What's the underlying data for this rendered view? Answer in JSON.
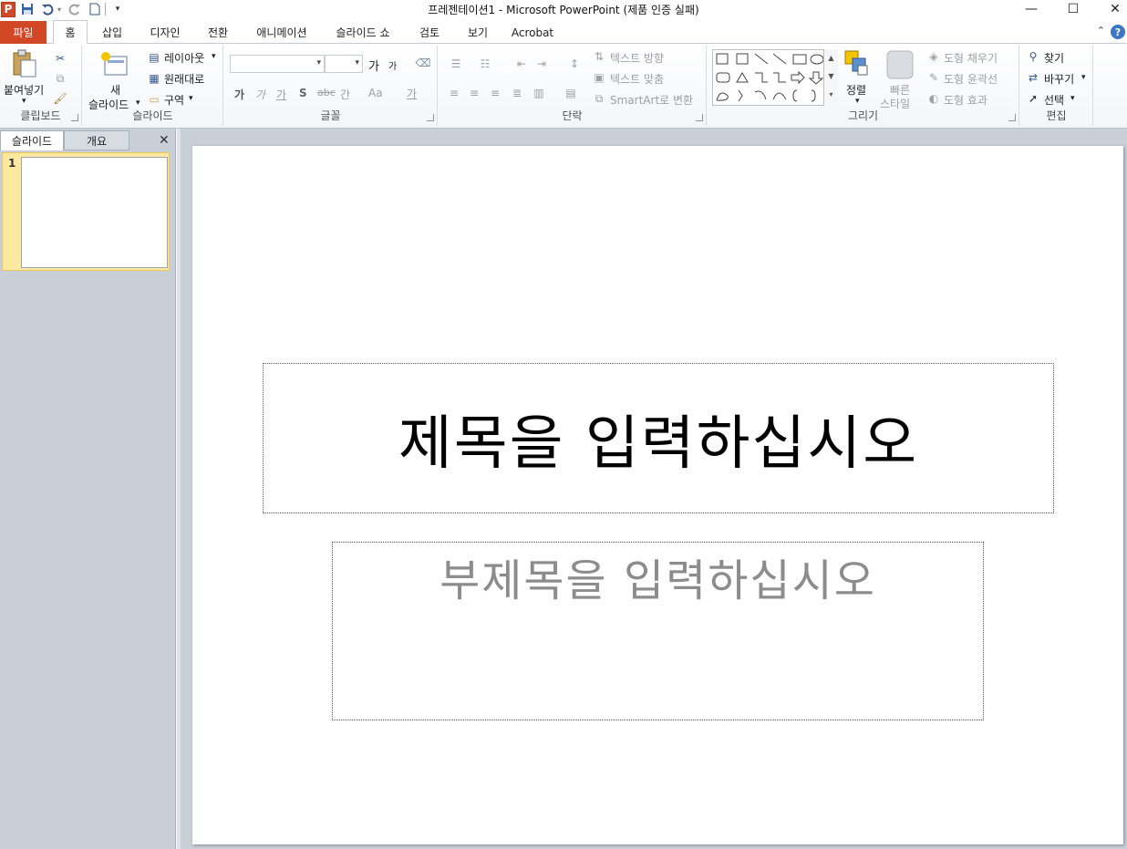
{
  "window": {
    "title": "프레젠테이션1  -  Microsoft PowerPoint (제품 인증 실패)",
    "app_icon_letter": "P",
    "controls": {
      "minimize": "—",
      "maximize": "☐",
      "close": "✕"
    }
  },
  "quick_access": [
    "save-icon",
    "undo-icon",
    "redo-icon",
    "new-document-icon",
    "customize-icon"
  ],
  "tabs": [
    {
      "label": "파일"
    },
    {
      "label": "홈"
    },
    {
      "label": "삽입"
    },
    {
      "label": "디자인"
    },
    {
      "label": "전환"
    },
    {
      "label": "애니메이션"
    },
    {
      "label": "슬라이드 쇼"
    },
    {
      "label": "검토"
    },
    {
      "label": "보기"
    },
    {
      "label": "Acrobat"
    }
  ],
  "ribbon": {
    "clipboard": {
      "paste": "붙여넣기",
      "label": "클립보드"
    },
    "slides": {
      "new_slide_line1": "새",
      "new_slide_line2": "슬라이드",
      "layout": "레이아웃",
      "reset": "원래대로",
      "section": "구역",
      "label": "슬라이드"
    },
    "font": {
      "label": "글꼴",
      "grow": "가",
      "shrink": "가",
      "bold": "가",
      "italic": "가",
      "underline": "가",
      "shadow": "S",
      "strike": "abc",
      "spacing": "간",
      "case": "Aa",
      "color": "가"
    },
    "paragraph": {
      "text_direction": "텍스트 방향",
      "align_text": "텍스트 맞춤",
      "smartart": "SmartArt로 변환",
      "label": "단락"
    },
    "drawing": {
      "arrange": "정렬",
      "quick_styles_line1": "빠른",
      "quick_styles_line2": "스타일",
      "shape_fill": "도형 채우기",
      "shape_outline": "도형 윤곽선",
      "shape_effects": "도형 효과",
      "label": "그리기"
    },
    "editing": {
      "find": "찾기",
      "replace": "바꾸기",
      "select": "선택",
      "label": "편집"
    }
  },
  "left_pane": {
    "tab_slides": "슬라이드",
    "tab_outline": "개요",
    "slide_number": "1"
  },
  "slide": {
    "title_placeholder": "제목을 입력하십시오",
    "subtitle_placeholder": "부제목을 입력하십시오"
  }
}
